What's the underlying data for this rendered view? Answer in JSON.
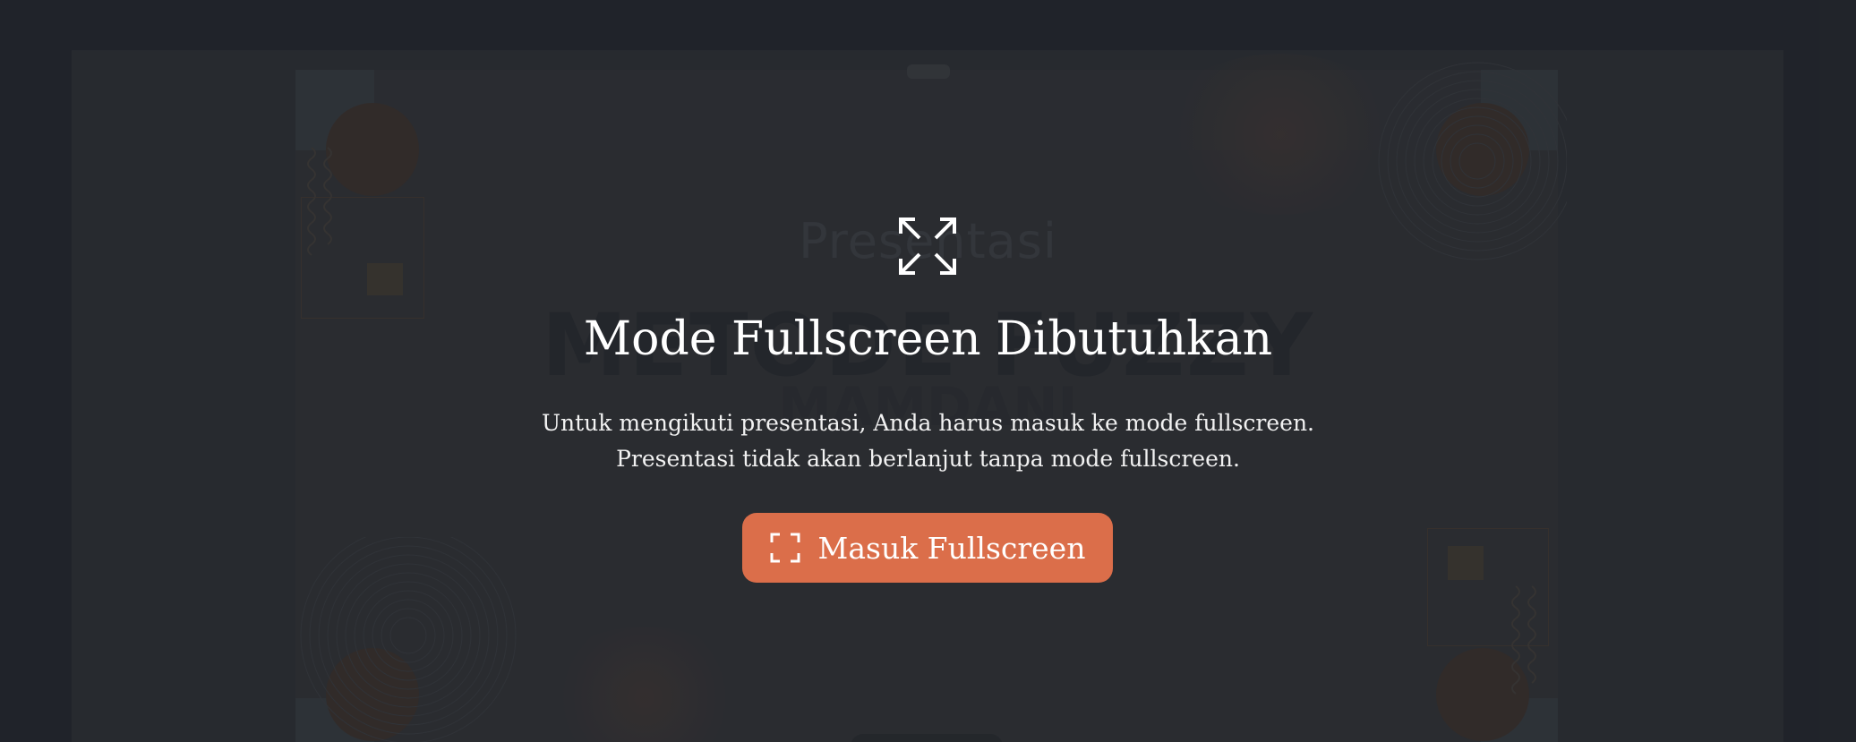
{
  "background_slide": {
    "subtitle": "Presentasi",
    "title_line1": "METODE FUZZY",
    "title_line2": "MAMDANI"
  },
  "modal": {
    "icon": "expand-icon",
    "title": "Mode Fullscreen Dibutuhkan",
    "text_line1": "Untuk mengikuti presentasi, Anda harus masuk ke mode fullscreen.",
    "text_line2": "Presentasi tidak akan berlanjut tanpa mode fullscreen.",
    "button": {
      "label": "Masuk Fullscreen",
      "icon": "fullscreen-icon",
      "color": "#db6e4a"
    }
  },
  "colors": {
    "page_background": "#20232a",
    "text": "#ffffff"
  }
}
